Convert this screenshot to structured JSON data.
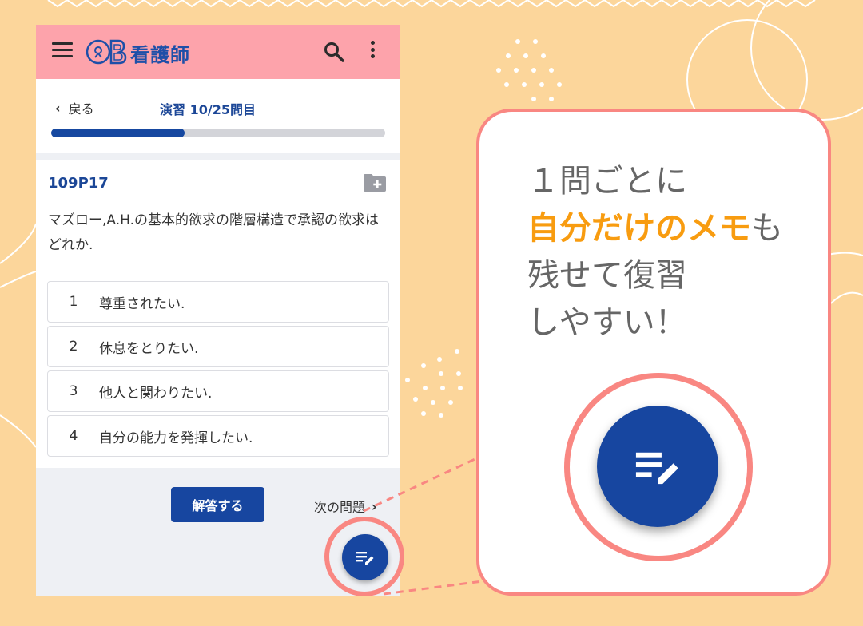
{
  "app": {
    "title": "看護師",
    "logo_letters": "OB"
  },
  "nav": {
    "back_label": "戻る",
    "title": "演習 10/25問目",
    "progress_fraction": 0.4
  },
  "question": {
    "id": "109P17",
    "text": "マズロー,A.H.の基本的欲求の階層構造で承認の欲求はどれか.",
    "choices": [
      {
        "num": "1",
        "label": "尊重されたい."
      },
      {
        "num": "2",
        "label": "休息をとりたい."
      },
      {
        "num": "3",
        "label": "他人と関わりたい."
      },
      {
        "num": "4",
        "label": "自分の能力を発揮したい."
      }
    ]
  },
  "actions": {
    "answer_label": "解答する",
    "next_label": "次の問題"
  },
  "callout": {
    "line1": "１問ごとに",
    "highlight": "自分だけのメモ",
    "line2_suffix": "も",
    "line3": "残せて復習",
    "line4": "しやすい！"
  },
  "colors": {
    "background": "#FCD69B",
    "appbar": "#FDA3AB",
    "primary": "#1746A0",
    "accent": "#F98782",
    "highlight": "#F89C10"
  },
  "icons": {
    "menu": "menu-icon",
    "search": "search-icon",
    "more": "more-vert-icon",
    "folder_add": "folder-add-icon",
    "memo": "memo-edit-icon"
  }
}
